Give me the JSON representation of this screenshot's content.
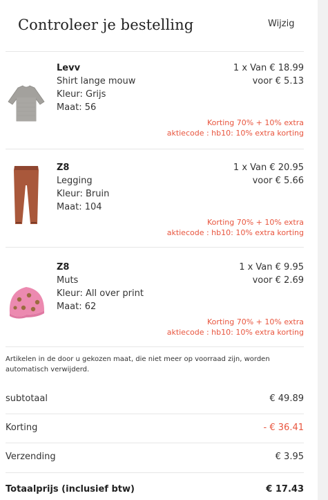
{
  "header": {
    "title": "Controleer je bestelling",
    "edit_label": "Wijzig"
  },
  "items": [
    {
      "brand": "Levv",
      "name": "Shirt lange mouw",
      "color": "Kleur: Grijs",
      "size": "Maat: 56",
      "qty_price": "1 x Van € 18.99",
      "sale_price": "voor € 5.13",
      "discount_line1": "Korting 70% + 10% extra",
      "discount_line2": "aktiecode : hb10: 10% extra korting",
      "image": "grey-long-sleeve-shirt"
    },
    {
      "brand": "Z8",
      "name": "Legging",
      "color": "Kleur: Bruin",
      "size": "Maat: 104",
      "qty_price": "1 x Van € 20.95",
      "sale_price": "voor € 5.66",
      "discount_line1": "Korting 70% + 10% extra",
      "discount_line2": "aktiecode : hb10: 10% extra korting",
      "image": "brown-legging"
    },
    {
      "brand": "Z8",
      "name": "Muts",
      "color": "Kleur: All over print",
      "size": "Maat: 62",
      "qty_price": "1 x Van € 9.95",
      "sale_price": "voor € 2.69",
      "discount_line1": "Korting 70% + 10% extra",
      "discount_line2": "aktiecode : hb10: 10% extra korting",
      "image": "pink-print-hat"
    }
  ],
  "note": "Artikelen in de door u gekozen maat, die niet meer op voorraad zijn, worden automatisch verwijderd.",
  "summary": {
    "subtotal_label": "subtotaal",
    "subtotal_value": "€ 49.89",
    "discount_label": "Korting",
    "discount_value": "- € 36.41",
    "shipping_label": "Verzending",
    "shipping_value": "€ 3.95",
    "total_label": "Totaalprijs (inclusief btw)",
    "total_value": "€ 17.43"
  },
  "colors": {
    "accent_red": "#e8553e",
    "divider": "#e6e6e6",
    "text": "#333333"
  }
}
